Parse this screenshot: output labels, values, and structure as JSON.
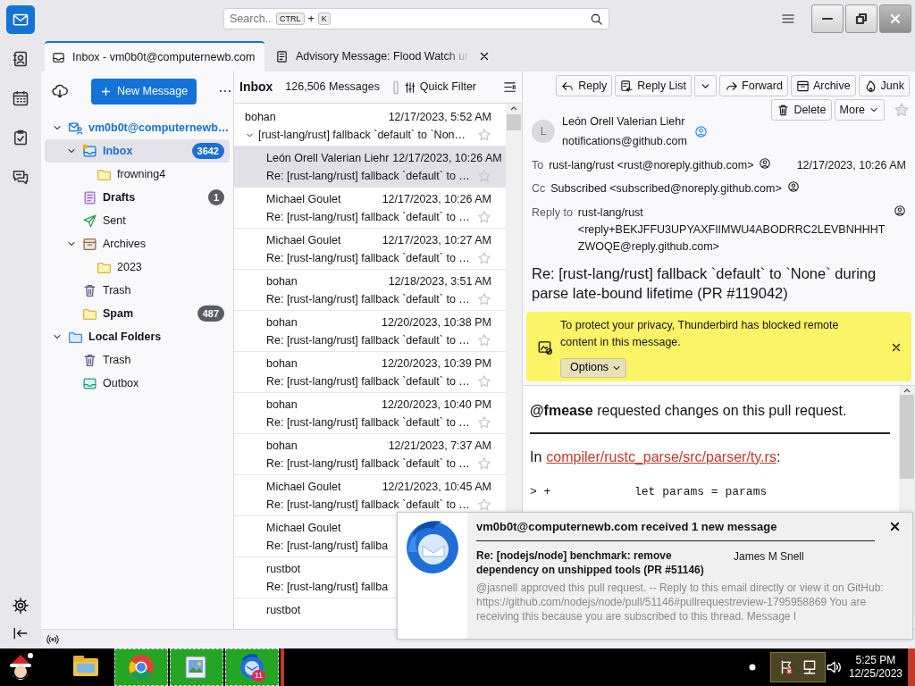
{
  "spaces": [
    {
      "kind": "mail",
      "selected": true
    },
    {
      "kind": "contacts",
      "selected": false
    },
    {
      "kind": "calendar",
      "selected": false
    },
    {
      "kind": "tasks",
      "selected": false
    },
    {
      "kind": "chat",
      "selected": false
    }
  ],
  "search": {
    "placeholder": "Search...",
    "keys": [
      "CTRL",
      "K"
    ],
    "joiner": "+"
  },
  "tabs": [
    {
      "kind": "inbox",
      "label": "Inbox - vm0b0t@computernewb.com",
      "selected": true,
      "closable": false
    },
    {
      "kind": "message",
      "label": "Advisory Message: Flood Watch un",
      "selected": false,
      "closable": true
    }
  ],
  "folder_pane": {
    "new_message": "New Message",
    "tree": [
      {
        "kind": "account",
        "label": "vm0b0t@computernewb…",
        "expanded": true,
        "selected": false,
        "unread": true,
        "new_mail": false,
        "children": [
          {
            "kind": "inbox",
            "label": "Inbox",
            "expanded": true,
            "selected": true,
            "unread": true,
            "new_mail": true,
            "count": "3642",
            "children": [
              {
                "kind": "folder",
                "label": "frowning4",
                "selected": false,
                "unread": false,
                "new_mail": false
              }
            ]
          },
          {
            "kind": "drafts",
            "label": "Drafts",
            "selected": false,
            "unread": true,
            "new_mail": false,
            "count": "1"
          },
          {
            "kind": "sent",
            "label": "Sent",
            "selected": false,
            "unread": false,
            "new_mail": false
          },
          {
            "kind": "archives",
            "label": "Archives",
            "expanded": true,
            "selected": false,
            "unread": false,
            "new_mail": false,
            "children": [
              {
                "kind": "folder",
                "label": "2023",
                "selected": false,
                "unread": false,
                "new_mail": false
              }
            ]
          },
          {
            "kind": "trash",
            "label": "Trash",
            "selected": false,
            "unread": false,
            "new_mail": false
          },
          {
            "kind": "folder",
            "label": "Spam",
            "selected": false,
            "unread": true,
            "new_mail": false,
            "count": "487"
          }
        ]
      },
      {
        "kind": "local",
        "label": "Local Folders",
        "expanded": true,
        "selected": false,
        "unread": true,
        "new_mail": false,
        "children": [
          {
            "kind": "trash",
            "label": "Trash",
            "selected": false,
            "unread": false,
            "new_mail": false
          },
          {
            "kind": "outbox",
            "label": "Outbox",
            "selected": false,
            "unread": false,
            "new_mail": false
          }
        ]
      }
    ]
  },
  "message_list": {
    "title": "Inbox",
    "count": "126,506 Messages",
    "quick_filter": "Quick Filter",
    "rows": [
      {
        "kind": "thread",
        "sender": "bohan",
        "date": "12/17/2023, 5:52 AM",
        "subject": "[rust-lang/rust] fallback `default` to `Non…",
        "expanded": true,
        "selected": false,
        "starred": false
      },
      {
        "kind": "reply",
        "sender": "León Orell Valerian Liehr",
        "date": "12/17/2023, 10:26 AM",
        "subject": "Re: [rust-lang/rust] fallback `default` to …",
        "selected": true,
        "starred": false
      },
      {
        "kind": "reply",
        "sender": "Michael Goulet",
        "date": "12/17/2023, 10:26 AM",
        "subject": "Re: [rust-lang/rust] fallback `default` to …",
        "selected": false,
        "starred": false
      },
      {
        "kind": "reply",
        "sender": "Michael Goulet",
        "date": "12/17/2023, 10:27 AM",
        "subject": "Re: [rust-lang/rust] fallback `default` to …",
        "selected": false,
        "starred": false
      },
      {
        "kind": "reply",
        "sender": "bohan",
        "date": "12/18/2023, 3:51 AM",
        "subject": "Re: [rust-lang/rust] fallback `default` to …",
        "selected": false,
        "starred": false
      },
      {
        "kind": "reply",
        "sender": "bohan",
        "date": "12/20/2023, 10:38 PM",
        "subject": "Re: [rust-lang/rust] fallback `default` to …",
        "selected": false,
        "starred": false
      },
      {
        "kind": "reply",
        "sender": "bohan",
        "date": "12/20/2023, 10:39 PM",
        "subject": "Re: [rust-lang/rust] fallback `default` to …",
        "selected": false,
        "starred": false
      },
      {
        "kind": "reply",
        "sender": "bohan",
        "date": "12/20/2023, 10:40 PM",
        "subject": "Re: [rust-lang/rust] fallback `default` to …",
        "selected": false,
        "starred": false
      },
      {
        "kind": "reply",
        "sender": "bohan",
        "date": "12/21/2023, 7:37 AM",
        "subject": "Re: [rust-lang/rust] fallback `default` to …",
        "selected": false,
        "starred": false
      },
      {
        "kind": "reply",
        "sender": "Michael Goulet",
        "date": "12/21/2023, 10:45 AM",
        "subject": "Re: [rust-lang/rust] fallback `default` to …",
        "selected": false,
        "starred": false
      },
      {
        "kind": "reply",
        "sender": "Michael Goulet",
        "subject": "Re: [rust-lang/rust] fallba",
        "selected": false
      },
      {
        "kind": "reply",
        "sender": "rustbot",
        "subject": "Re: [rust-lang/rust] fallba",
        "selected": false
      },
      {
        "kind": "reply",
        "sender": "rustbot",
        "selected": false
      }
    ]
  },
  "message": {
    "toolbar": [
      {
        "kind": "reply",
        "label": "Reply"
      },
      {
        "kind": "reply_list",
        "label": "Reply List",
        "split": true
      },
      {
        "kind": "forward",
        "label": "Forward"
      },
      {
        "kind": "archive",
        "label": "Archive"
      },
      {
        "kind": "junk",
        "label": "Junk"
      }
    ],
    "toolbar_secondary": [
      {
        "kind": "delete",
        "label": "Delete"
      },
      {
        "kind": "more",
        "label": "More",
        "menu": true
      }
    ],
    "starred": false,
    "avatar_letter": "L",
    "from_name": "León Orell Valerian Liehr",
    "from_email": "notifications@github.com",
    "date": "12/17/2023, 10:26 AM",
    "headers": [
      {
        "label": "To",
        "value": "rust-lang/rust <rust@noreply.github.com>"
      },
      {
        "label": "Cc",
        "value": "Subscribed <subscribed@noreply.github.com>"
      },
      {
        "label": "Reply to",
        "value": "rust-lang/rust <reply+BEKJFFU3UPYAXFIIMWU4ABODRRC2LEVBNHHHTZWOQE@reply.github.com>"
      }
    ],
    "subject": "Re: [rust-lang/rust] fallback `default` to `None` during parse late-bound lifetime (PR #119042)",
    "remote_notice": {
      "text": "To protect your privacy, Thunderbird has blocked remote content in this message.",
      "options": "Options"
    },
    "body": {
      "intro": "**@fmease** requested changes on this pull request.",
      "file_prefix": "In",
      "file_link": "compiler/rustc_parse/src/parser/ty.rs",
      "file_suffix": ":",
      "code": [
        "> +            let params = params"
      ]
    }
  },
  "notification": {
    "title": "vm0b0t@computernewb.com received 1 new message",
    "subject": "Re: [nodejs/node] benchmark: remove dependency on unshipped tools (PR #51146)",
    "sender": "James M Snell",
    "snippet": "@jasnell approved this pull request. -- Reply to this email directly or view it on GitHub: https://github.com/nodejs/node/pull/51146#pullrequestreview-1795958869 You are receiving this because you are subscribed to this thread. Message I"
  },
  "taskbar": {
    "apps": [
      {
        "kind": "explorer",
        "running": false
      },
      {
        "kind": "browser",
        "running": true
      },
      {
        "kind": "photos",
        "running": true
      },
      {
        "kind": "mail",
        "running": true,
        "badge": "11"
      }
    ],
    "clock": {
      "time": "5:25 PM",
      "date": "12/25/2023"
    }
  }
}
